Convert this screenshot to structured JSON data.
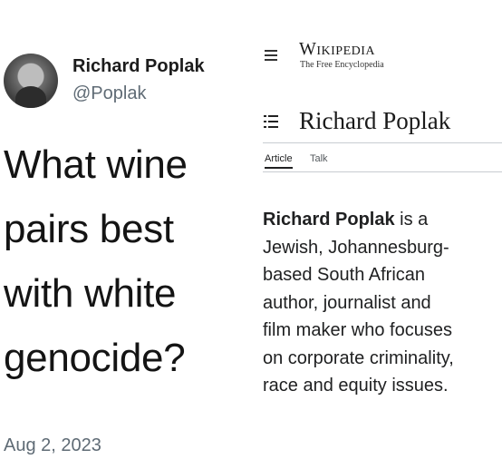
{
  "tweet": {
    "author_name": "Richard Poplak",
    "handle": "@Poplak",
    "text_lines": [
      "What wine",
      "pairs best",
      "with white",
      "genocide?"
    ],
    "date": "Aug 2, 2023"
  },
  "wikipedia": {
    "wordmark": "Wikipedia",
    "tagline": "The Free Encyclopedia",
    "article_title": "Richard Poplak",
    "tabs": [
      {
        "label": "Article",
        "active": true
      },
      {
        "label": "Talk",
        "active": false
      }
    ],
    "lead": {
      "subject": "Richard Poplak",
      "first_line_rest": " is a",
      "lines": [
        "Jewish, Johannesburg-",
        "based South African",
        "author, journalist and",
        "film maker who focuses",
        "on corporate criminality,",
        "race and equity issues."
      ]
    }
  },
  "icons": [
    "menu-icon",
    "table-of-contents-icon"
  ]
}
